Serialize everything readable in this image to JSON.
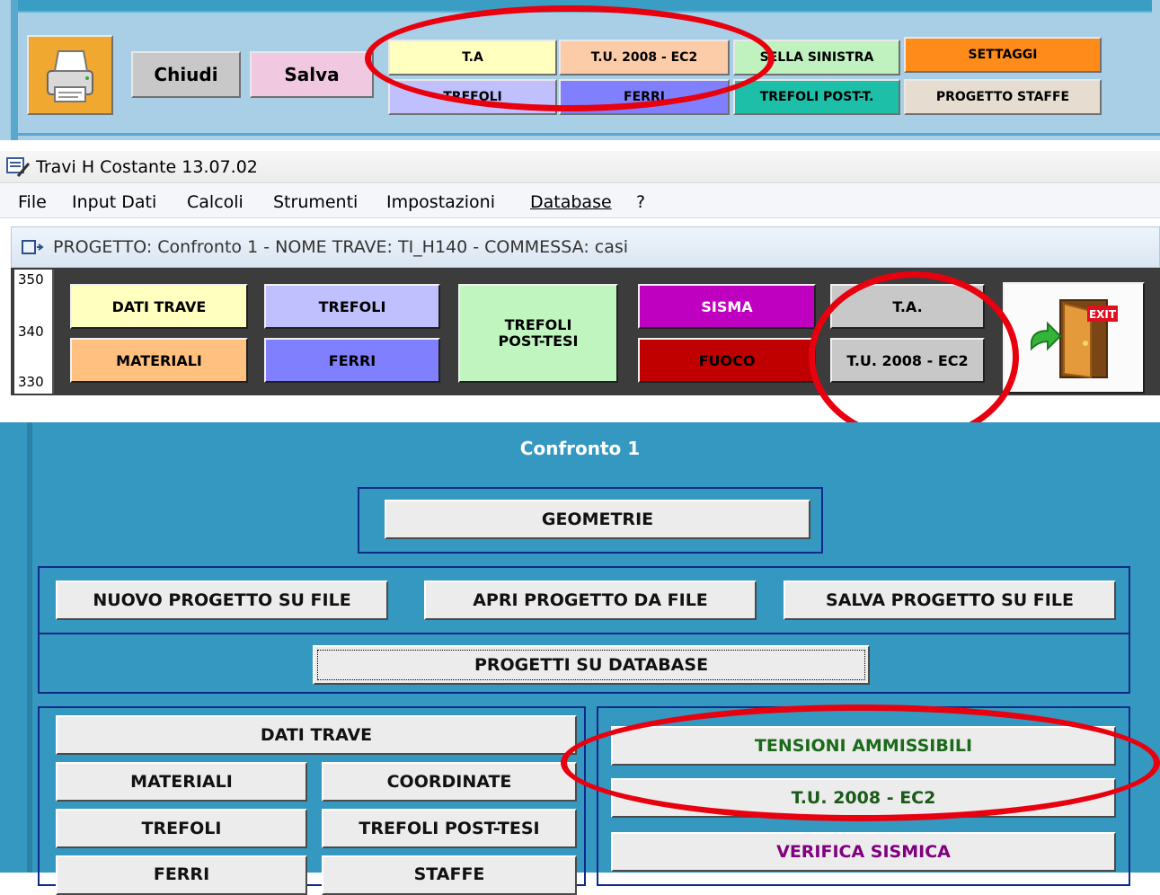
{
  "toolbar_top": {
    "printer_icon": "printer-icon",
    "chiudi": "Chiudi",
    "salva": "Salva",
    "ta": "T.A",
    "tu2008": "T.U. 2008 - EC2",
    "sella_sinistra": "SELLA SINISTRA",
    "settaggi": "SETTAGGI",
    "trefoli": "TREFOLI",
    "ferri": "FERRI",
    "trefoli_post": "TREFOLI POST-T.",
    "progetto_staffe": "PROGETTO STAFFE",
    "colors": {
      "ta": "#ffffc0",
      "tu": "#fccca8",
      "sella": "#c0f2c0",
      "settaggi": "#ff8c1a",
      "trefoli": "#c0c0ff",
      "ferri": "#8080ff",
      "trefoli_post": "#1dbfa8",
      "progetto_staffe": "#e6ddd0",
      "chiudi": "#c8c8c8",
      "salva": "#f0c8e0"
    }
  },
  "window": {
    "title": "Travi H Costante  13.07.02",
    "menu": [
      "File",
      "Input Dati",
      "Calcoli",
      "Strumenti",
      "Impostazioni",
      "Database",
      "?"
    ],
    "document_title": "PROGETTO: Confronto 1 - NOME TRAVE: TI_H140 - COMMESSA: casi"
  },
  "ribbon": {
    "ticks": [
      "350",
      "340",
      "330"
    ],
    "dati_trave": "DATI TRAVE",
    "materiali": "MATERIALI",
    "trefoli": "TREFOLI",
    "ferri": "FERRI",
    "trefoli_post_tesi_line1": "TREFOLI",
    "trefoli_post_tesi_line2": "POST-TESI",
    "sisma": "SISMA",
    "fuoco": "FUOCO",
    "ta": "T.A.",
    "tu2008": "T.U. 2008 - EC2",
    "exit_label": "EXIT",
    "colors": {
      "dati_trave": "#ffffc0",
      "materiali": "#ffc080",
      "trefoli": "#c0c0ff",
      "ferri": "#8080ff",
      "trefoli_post": "#c0f5c0",
      "sisma": "#c000c0",
      "fuoco": "#c00000",
      "ta": "#c8c8c8",
      "tu": "#c8c8c8"
    }
  },
  "main_panel": {
    "project_name": "Confronto 1",
    "geometrie": "GEOMETRIE",
    "nuovo_progetto": "NUOVO PROGETTO SU FILE",
    "apri_progetto": "APRI PROGETTO DA FILE",
    "salva_progetto": "SALVA PROGETTO SU FILE",
    "progetti_database": "PROGETTI SU DATABASE",
    "dati_trave": "DATI TRAVE",
    "materiali": "MATERIALI",
    "coordinate": "COORDINATE",
    "trefoli": "TREFOLI",
    "trefoli_post_tesi": "TREFOLI POST-TESI",
    "ferri": "FERRI",
    "staffe": "STAFFE",
    "tensioni_ammissibili": "TENSIONI AMMISSIBILI",
    "tu2008": "T.U. 2008 - EC2",
    "verifica_sismica": "VERIFICA SISMICA",
    "colors": {
      "tensioni": "#1a6a1a",
      "tu": "#1a5a1a",
      "sismica": "#800080"
    }
  }
}
